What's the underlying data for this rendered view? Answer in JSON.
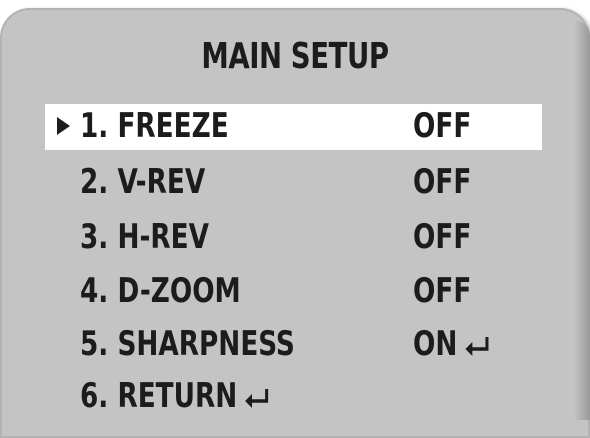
{
  "menu": {
    "title": "MAIN SETUP",
    "items": [
      {
        "label": "1. FREEZE",
        "value": "OFF",
        "selected": true,
        "submenu": false
      },
      {
        "label": "2. V-REV",
        "value": "OFF",
        "selected": false,
        "submenu": false
      },
      {
        "label": "3. H-REV",
        "value": "OFF",
        "selected": false,
        "submenu": false
      },
      {
        "label": "4. D-ZOOM",
        "value": "OFF",
        "selected": false,
        "submenu": false
      },
      {
        "label": "5. SHARPNESS",
        "value": "ON",
        "selected": false,
        "submenu": true
      },
      {
        "label": "6. RETURN",
        "value": "",
        "selected": false,
        "submenu": true
      }
    ],
    "cursor_icon": "triangle-right-icon",
    "submenu_icon": "enter-arrow-icon"
  },
  "colors": {
    "panel": "#c4c4c4",
    "highlight": "#ffffff",
    "text": "#1c1c1c"
  }
}
